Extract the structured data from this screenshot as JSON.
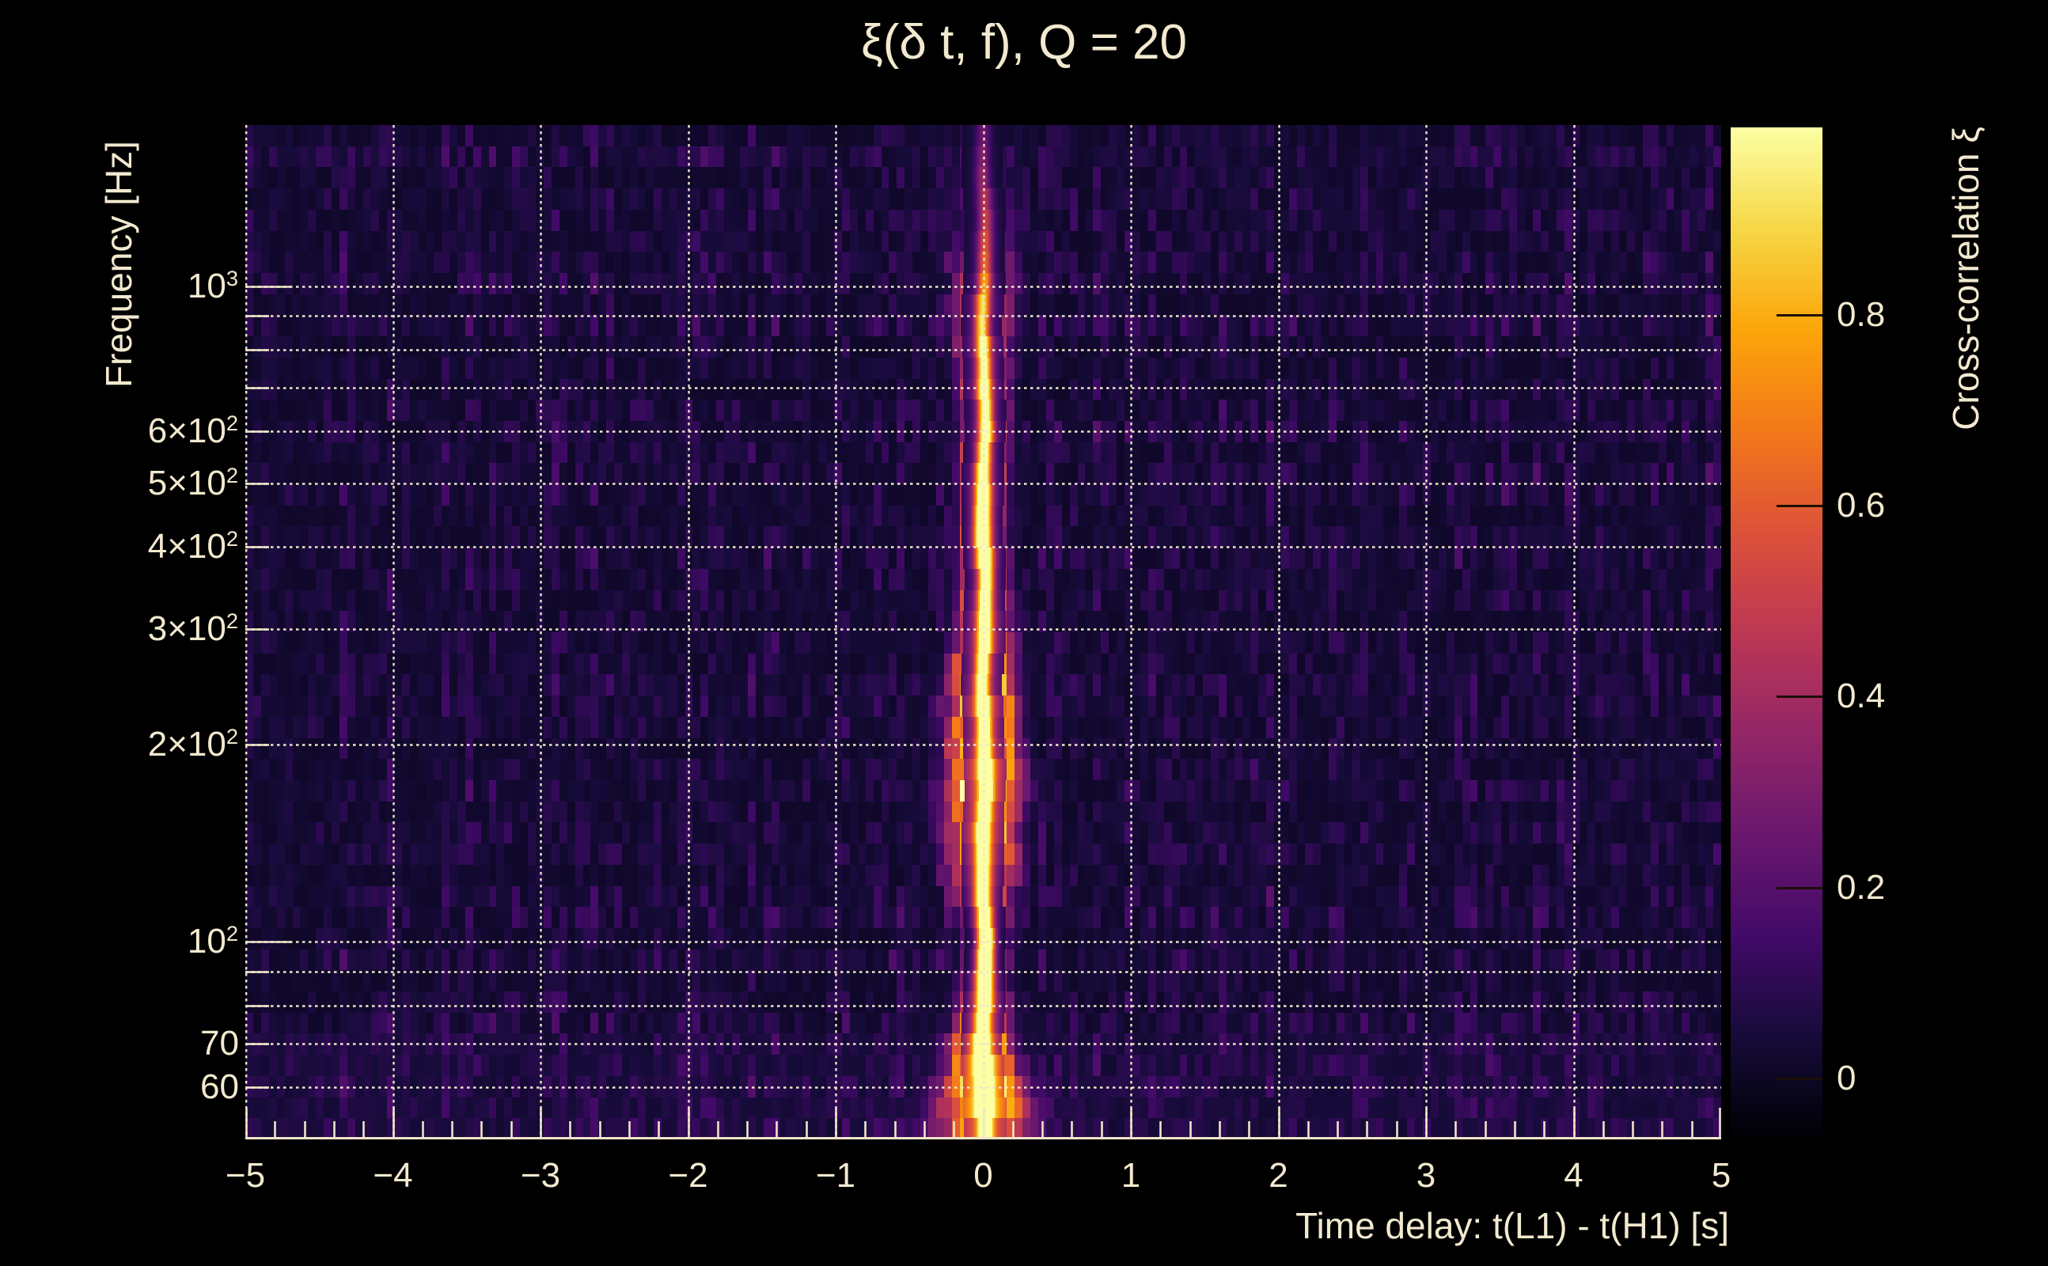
{
  "title": "ξ(δ t, f), Q = 20",
  "axes": {
    "x_label": "Time delay: t(L1) - t(H1) [s]",
    "y_label": "Frequency [Hz]",
    "colorbar_label": "Cross-correlation ξ"
  },
  "colors": {
    "background": "#000000",
    "text": "#f2e9cf",
    "grid": "#efe5c8",
    "axis_line": "#efe5c8",
    "colorbar_tick": "#1c0f05"
  },
  "chart_data": {
    "type": "heatmap",
    "title": "ξ(δ t, f), Q = 20",
    "q_value": 20,
    "xlabel": "Time delay: t(L1) - t(H1) [s]",
    "ylabel": "Frequency [Hz]",
    "colorbar_label": "Cross-correlation ξ",
    "xlim": [
      -5,
      5
    ],
    "x_major_ticks": [
      -5,
      -4,
      -3,
      -2,
      -1,
      0,
      1,
      2,
      3,
      4,
      5
    ],
    "x_tick_labels": [
      "−5",
      "−4",
      "−3",
      "−2",
      "−1",
      "0",
      "1",
      "2",
      "3",
      "4",
      "5"
    ],
    "x_minor_step": 0.2,
    "y_scale": "log",
    "ylim_hz": [
      50,
      1760
    ],
    "y_grid_freqs": [
      60,
      70,
      80,
      90,
      100,
      200,
      300,
      400,
      500,
      600,
      700,
      800,
      900,
      1000
    ],
    "y_major_tick_freqs": [
      100,
      1000
    ],
    "y_tick_labels": [
      {
        "f": 1000,
        "base": "10",
        "exp": "3"
      },
      {
        "f": 600,
        "base": "6×10",
        "exp": "2"
      },
      {
        "f": 500,
        "base": "5×10",
        "exp": "2"
      },
      {
        "f": 400,
        "base": "4×10",
        "exp": "2"
      },
      {
        "f": 300,
        "base": "3×10",
        "exp": "2"
      },
      {
        "f": 200,
        "base": "2×10",
        "exp": "2"
      },
      {
        "f": 100,
        "base": "10",
        "exp": "2"
      },
      {
        "f": 70,
        "base": "70",
        "exp": ""
      },
      {
        "f": 60,
        "base": "60",
        "exp": ""
      }
    ],
    "grid_style": "dotted",
    "colorbar": {
      "position": "right",
      "ticks": [
        0,
        0.2,
        0.4,
        0.6,
        0.8
      ],
      "tick_labels": [
        "0",
        "0.2",
        "0.4",
        "0.6",
        "0.8"
      ],
      "vmin": -0.063,
      "vmax": 0.996,
      "colormap": "inferno",
      "colormap_stops": [
        "#000004",
        "#160b39",
        "#420a68",
        "#6a176e",
        "#932667",
        "#bc3754",
        "#dd513a",
        "#f37819",
        "#fca50a",
        "#f6d746",
        "#fcffa4"
      ]
    },
    "noise_floor_xi": [
      0,
      0.12
    ],
    "ridge": {
      "description": "Bright cross-correlation ridge at time delay ≈ 0 s spanning the full 50–1760 Hz band; near-white core (ξ ≈ 1), orange blocky side-lobes within ±0.3 s, widest below 100 Hz and around 150–450 Hz; faint narrow core above 1 kHz.",
      "t0_s": 0,
      "core_sigma_s": 0.035,
      "profile": [
        {
          "f": 1700,
          "core": 0.18,
          "halo": 0.05,
          "halo_w_s": 0.05,
          "side": 0.04,
          "side_d_s": 0.1
        },
        {
          "f": 1500,
          "core": 0.26,
          "halo": 0.07,
          "halo_w_s": 0.06,
          "side": 0.06,
          "side_d_s": 0.12
        },
        {
          "f": 1300,
          "core": 0.35,
          "halo": 0.08,
          "halo_w_s": 0.07,
          "side": 0.1,
          "side_d_s": 0.14
        },
        {
          "f": 1100,
          "core": 0.5,
          "halo": 0.1,
          "halo_w_s": 0.08,
          "side": 0.15,
          "side_d_s": 0.15
        },
        {
          "f": 1000,
          "core": 0.62,
          "halo": 0.15,
          "halo_w_s": 0.09,
          "side": 0.25,
          "side_d_s": 0.14
        },
        {
          "f": 900,
          "core": 0.72,
          "halo": 0.18,
          "halo_w_s": 0.1,
          "side": 0.32,
          "side_d_s": 0.13
        },
        {
          "f": 800,
          "core": 0.82,
          "halo": 0.22,
          "halo_w_s": 0.1,
          "side": 0.35,
          "side_d_s": 0.12
        },
        {
          "f": 700,
          "core": 0.88,
          "halo": 0.25,
          "halo_w_s": 0.09,
          "side": 0.32,
          "side_d_s": 0.11
        },
        {
          "f": 600,
          "core": 0.9,
          "halo": 0.28,
          "halo_w_s": 0.08,
          "side": 0.35,
          "side_d_s": 0.1
        },
        {
          "f": 500,
          "core": 0.93,
          "halo": 0.32,
          "halo_w_s": 0.08,
          "side": 0.38,
          "side_d_s": 0.1
        },
        {
          "f": 450,
          "core": 0.96,
          "halo": 0.4,
          "halo_w_s": 0.07,
          "side": 0.42,
          "side_d_s": 0.09
        },
        {
          "f": 400,
          "core": 0.98,
          "halo": 0.45,
          "halo_w_s": 0.07,
          "side": 0.45,
          "side_d_s": 0.09
        },
        {
          "f": 350,
          "core": 0.92,
          "halo": 0.38,
          "halo_w_s": 0.08,
          "side": 0.35,
          "side_d_s": 0.1
        },
        {
          "f": 300,
          "core": 0.95,
          "halo": 0.45,
          "halo_w_s": 0.1,
          "side": 0.4,
          "side_d_s": 0.12
        },
        {
          "f": 250,
          "core": 0.9,
          "halo": 0.4,
          "halo_w_s": 0.12,
          "side": 0.45,
          "side_d_s": 0.15
        },
        {
          "f": 200,
          "core": 0.94,
          "halo": 0.42,
          "halo_w_s": 0.12,
          "side": 0.5,
          "side_d_s": 0.16
        },
        {
          "f": 170,
          "core": 0.92,
          "halo": 0.55,
          "halo_w_s": 0.14,
          "side": 0.55,
          "side_d_s": 0.17
        },
        {
          "f": 150,
          "core": 0.95,
          "halo": 0.6,
          "halo_w_s": 0.13,
          "side": 0.45,
          "side_d_s": 0.15
        },
        {
          "f": 130,
          "core": 0.88,
          "halo": 0.4,
          "halo_w_s": 0.1,
          "side": 0.4,
          "side_d_s": 0.18
        },
        {
          "f": 110,
          "core": 0.9,
          "halo": 0.35,
          "halo_w_s": 0.07,
          "side": 0.25,
          "side_d_s": 0.12
        },
        {
          "f": 100,
          "core": 0.97,
          "halo": 0.5,
          "halo_w_s": 0.05,
          "side": 0.2,
          "side_d_s": 0.1
        },
        {
          "f": 90,
          "core": 0.94,
          "halo": 0.5,
          "halo_w_s": 0.06,
          "side": 0.25,
          "side_d_s": 0.1
        },
        {
          "f": 80,
          "core": 0.92,
          "halo": 0.55,
          "halo_w_s": 0.08,
          "side": 0.3,
          "side_d_s": 0.11
        },
        {
          "f": 70,
          "core": 0.95,
          "halo": 0.72,
          "halo_w_s": 0.1,
          "side": 0.35,
          "side_d_s": 0.13
        },
        {
          "f": 62,
          "core": 0.97,
          "halo": 0.85,
          "halo_w_s": 0.13,
          "side": 0.3,
          "side_d_s": 0.18
        },
        {
          "f": 55,
          "core": 0.9,
          "halo": 0.7,
          "halo_w_s": 0.18,
          "side": 0.2,
          "side_d_s": 0.25
        },
        {
          "f": 50,
          "core": 0.8,
          "halo": 0.55,
          "halo_w_s": 0.2,
          "side": 0.1,
          "side_d_s": 0.28
        }
      ]
    }
  }
}
